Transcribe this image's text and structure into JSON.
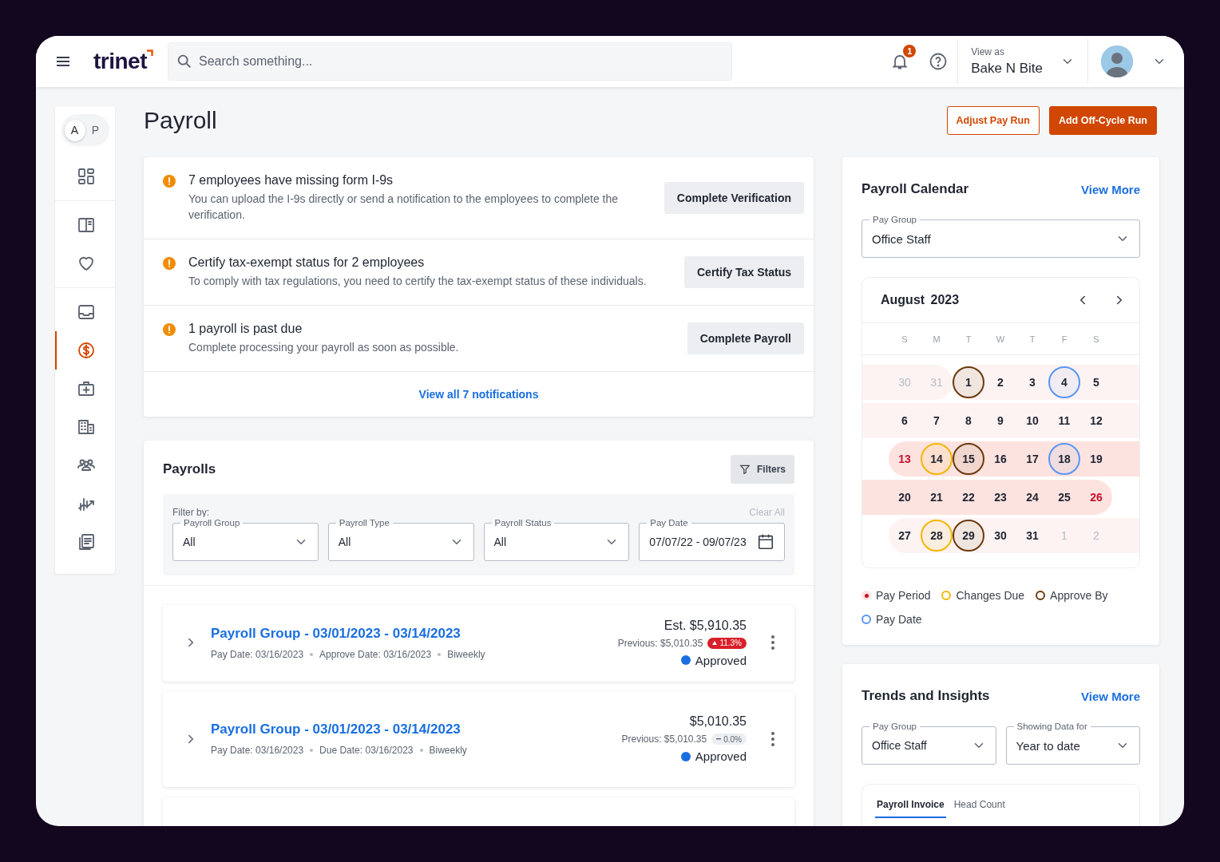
{
  "header": {
    "logo": "trinet",
    "search": {
      "placeholder": "Search something..."
    },
    "notification_count": "1",
    "view_as": {
      "label": "View as",
      "value": "Bake N Bite"
    }
  },
  "sidebar": {
    "toggle": [
      {
        "label": "A",
        "selected": true
      },
      {
        "label": "P",
        "selected": false
      }
    ],
    "groups": [
      {
        "items": [
          {
            "kind": "dashboard",
            "selected": false
          }
        ]
      },
      {
        "items": [
          {
            "kind": "book",
            "selected": false
          },
          {
            "kind": "heart",
            "selected": false
          }
        ]
      },
      {
        "items": [
          {
            "kind": "inbox",
            "selected": false
          },
          {
            "kind": "dollar",
            "selected": true
          },
          {
            "kind": "medical",
            "selected": false
          },
          {
            "kind": "building",
            "selected": false
          },
          {
            "kind": "people",
            "selected": false
          },
          {
            "kind": "chart",
            "selected": false
          },
          {
            "kind": "documents",
            "selected": false
          }
        ]
      }
    ]
  },
  "page": {
    "title": "Payroll",
    "actions": [
      {
        "label": "Adjust Pay Run",
        "kind": "outline"
      },
      {
        "label": "Add Off-Cycle Run",
        "kind": "primary"
      }
    ]
  },
  "notifications": {
    "items": [
      {
        "title": "7 employees have missing form I-9s",
        "description": "You can upload the I-9s directly or send a notification to the employees to complete the verification.",
        "action": "Complete Verification"
      },
      {
        "title": "Certify tax-exempt status for 2 employees",
        "description": "To comply with tax regulations, you need to certify the tax-exempt status of these individuals.",
        "action": "Certify Tax Status"
      },
      {
        "title": "1 payroll is past due",
        "description": "Complete processing your payroll as soon as possible.",
        "action": "Complete Payroll"
      }
    ],
    "footer_link": "View all 7 notifications"
  },
  "payrolls": {
    "title": "Payrolls",
    "filters_button": "Filters",
    "filter_label": "Filter by:",
    "clear_all": {
      "label": "Clear All",
      "disabled": true
    },
    "filters": [
      {
        "label": "Payroll Group",
        "value": "All",
        "kind": "select"
      },
      {
        "label": "Payroll Type",
        "value": "All",
        "kind": "select"
      },
      {
        "label": "Payroll Status",
        "value": "All",
        "kind": "select"
      },
      {
        "label": "Pay Date",
        "value": "07/07/22 - 09/07/23",
        "kind": "date"
      }
    ],
    "rows": [
      {
        "title": "Payroll Group - 03/01/2023 - 03/14/2023",
        "meta": [
          "Pay Date: 03/16/2023",
          "Approve Date: 03/16/2023",
          "Biweekly"
        ],
        "amount": "Est. $5,910.35",
        "previous": "Previous: $5,010.35",
        "change": {
          "text": "11.3%",
          "kind": "up"
        },
        "status": {
          "text": "Approved",
          "color": "#1a6fe0"
        }
      },
      {
        "title": "Payroll Group - 03/01/2023 - 03/14/2023",
        "meta": [
          "Pay Date: 03/16/2023",
          "Due Date: 03/16/2023",
          "Biweekly"
        ],
        "amount": "$5,010.35",
        "previous": "Previous: $5,010.35",
        "change": {
          "text": "0.0%",
          "kind": "flat"
        },
        "status": {
          "text": "Approved",
          "color": "#1a6fe0"
        }
      }
    ]
  },
  "payroll_calendar": {
    "title": "Payroll Calendar",
    "view_more": "View More",
    "pay_group": {
      "label": "Pay Group",
      "value": "Office Staff"
    },
    "month": "August 2023",
    "weekdays": [
      "S",
      "M",
      "T",
      "W",
      "T",
      "F",
      "S"
    ],
    "weeks": [
      {
        "days": [
          {
            "day": "30",
            "kind": "plain",
            "muted": true,
            "red": false,
            "current_period": false,
            "period_start": false,
            "period_end": false
          },
          {
            "day": "31",
            "kind": "plain",
            "muted": true,
            "red": false,
            "current_period": false,
            "period_start": false,
            "period_end": true
          },
          {
            "day": "1",
            "kind": "approve",
            "muted": false,
            "red": false,
            "current_period": false,
            "period_start": true,
            "period_end": false
          },
          {
            "day": "2",
            "kind": "plain",
            "muted": false,
            "red": false,
            "current_period": false,
            "period_start": false,
            "period_end": false
          },
          {
            "day": "3",
            "kind": "plain",
            "muted": false,
            "red": false,
            "current_period": false,
            "period_start": false,
            "period_end": false
          },
          {
            "day": "4",
            "kind": "pay",
            "muted": false,
            "red": false,
            "current_period": false,
            "period_start": false,
            "period_end": false
          },
          {
            "day": "5",
            "kind": "plain",
            "muted": false,
            "red": false,
            "current_period": false,
            "period_start": false,
            "period_end": false
          }
        ]
      },
      {
        "days": [
          {
            "day": "6",
            "kind": "plain",
            "muted": false,
            "red": false,
            "current_period": false,
            "period_start": false,
            "period_end": false
          },
          {
            "day": "7",
            "kind": "plain",
            "muted": false,
            "red": false,
            "current_period": false,
            "period_start": false,
            "period_end": false
          },
          {
            "day": "8",
            "kind": "plain",
            "muted": false,
            "red": false,
            "current_period": false,
            "period_start": false,
            "period_end": false
          },
          {
            "day": "9",
            "kind": "plain",
            "muted": false,
            "red": false,
            "current_period": false,
            "period_start": false,
            "period_end": false
          },
          {
            "day": "10",
            "kind": "plain",
            "muted": false,
            "red": false,
            "current_period": false,
            "period_start": false,
            "period_end": false
          },
          {
            "day": "11",
            "kind": "plain",
            "muted": false,
            "red": false,
            "current_period": false,
            "period_start": false,
            "period_end": false
          },
          {
            "day": "12",
            "kind": "plain",
            "muted": false,
            "red": false,
            "current_period": false,
            "period_start": false,
            "period_end": false
          }
        ]
      },
      {
        "days": [
          {
            "day": "13",
            "kind": "plain",
            "muted": false,
            "red": true,
            "current_period": true,
            "period_start": true,
            "period_end": false
          },
          {
            "day": "14",
            "kind": "changes",
            "muted": false,
            "red": false,
            "current_period": true,
            "period_start": false,
            "period_end": false
          },
          {
            "day": "15",
            "kind": "approve",
            "muted": false,
            "red": false,
            "current_period": true,
            "period_start": false,
            "period_end": false
          },
          {
            "day": "16",
            "kind": "plain",
            "muted": false,
            "red": false,
            "current_period": true,
            "period_start": false,
            "period_end": false
          },
          {
            "day": "17",
            "kind": "plain",
            "muted": false,
            "red": false,
            "current_period": true,
            "period_start": false,
            "period_end": false
          },
          {
            "day": "18",
            "kind": "pay",
            "muted": false,
            "red": false,
            "current_period": true,
            "period_start": false,
            "period_end": false
          },
          {
            "day": "19",
            "kind": "plain",
            "muted": false,
            "red": false,
            "current_period": true,
            "period_start": false,
            "period_end": false
          }
        ]
      },
      {
        "days": [
          {
            "day": "20",
            "kind": "plain",
            "muted": false,
            "red": false,
            "current_period": true,
            "period_start": false,
            "period_end": false
          },
          {
            "day": "21",
            "kind": "plain",
            "muted": false,
            "red": false,
            "current_period": true,
            "period_start": false,
            "period_end": false
          },
          {
            "day": "22",
            "kind": "plain",
            "muted": false,
            "red": false,
            "current_period": true,
            "period_start": false,
            "period_end": false
          },
          {
            "day": "23",
            "kind": "plain",
            "muted": false,
            "red": false,
            "current_period": true,
            "period_start": false,
            "period_end": false
          },
          {
            "day": "24",
            "kind": "plain",
            "muted": false,
            "red": false,
            "current_period": true,
            "period_start": false,
            "period_end": false
          },
          {
            "day": "25",
            "kind": "plain",
            "muted": false,
            "red": false,
            "current_period": true,
            "period_start": false,
            "period_end": false
          },
          {
            "day": "26",
            "kind": "plain",
            "muted": false,
            "red": true,
            "current_period": true,
            "period_start": false,
            "period_end": true
          }
        ]
      },
      {
        "days": [
          {
            "day": "27",
            "kind": "plain",
            "muted": false,
            "red": false,
            "current_period": false,
            "period_start": true,
            "period_end": false
          },
          {
            "day": "28",
            "kind": "changes",
            "muted": false,
            "red": false,
            "current_period": false,
            "period_start": false,
            "period_end": false
          },
          {
            "day": "29",
            "kind": "approve",
            "muted": false,
            "red": false,
            "current_period": false,
            "period_start": false,
            "period_end": false
          },
          {
            "day": "30",
            "kind": "plain",
            "muted": false,
            "red": false,
            "current_period": false,
            "period_start": false,
            "period_end": false
          },
          {
            "day": "31",
            "kind": "plain",
            "muted": false,
            "red": false,
            "current_period": false,
            "period_start": false,
            "period_end": false
          },
          {
            "day": "1",
            "kind": "plain",
            "muted": true,
            "red": false,
            "current_period": false,
            "period_start": false,
            "period_end": false
          },
          {
            "day": "2",
            "kind": "plain",
            "muted": true,
            "red": false,
            "current_period": false,
            "period_start": false,
            "period_end": false
          }
        ]
      }
    ],
    "legend": [
      {
        "label": "Pay Period",
        "kind": "period",
        "color": "#c8102e"
      },
      {
        "label": "Changes Due",
        "kind": "changes",
        "color": "#f2b705"
      },
      {
        "label": "Approve By",
        "kind": "approve",
        "color": "#6b3a0e"
      },
      {
        "label": "Pay Date",
        "kind": "pay",
        "color": "#5a95f5"
      }
    ]
  },
  "trends": {
    "title": "Trends and Insights",
    "view_more": "View More",
    "filters": [
      {
        "label": "Pay Group",
        "value": "Office Staff"
      },
      {
        "label": "Showing Data for",
        "value": "Year to date"
      }
    ],
    "tabs": [
      {
        "label": "Payroll Invoice",
        "selected": true
      },
      {
        "label": "Head Count",
        "selected": false
      }
    ]
  }
}
